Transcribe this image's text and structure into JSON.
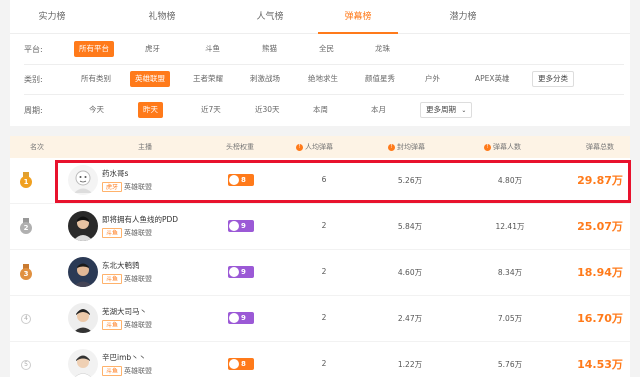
{
  "top_tabs": [
    {
      "label": "实力榜"
    },
    {
      "label": "礼物榜"
    },
    {
      "label": "人气榜"
    },
    {
      "label": "弹幕榜"
    },
    {
      "label": "潜力榜"
    }
  ],
  "filters": {
    "platform": {
      "label": "平台:",
      "options": [
        "所有平台",
        "虎牙",
        "斗鱼",
        "熊猫",
        "全民",
        "龙珠"
      ],
      "selected": "所有平台"
    },
    "category": {
      "label": "类别:",
      "options": [
        "所有类别",
        "英雄联盟",
        "王者荣耀",
        "刺激战场",
        "绝地求生",
        "颜值星秀",
        "户外",
        "APEX英雄"
      ],
      "more": "更多分类",
      "selected": "英雄联盟"
    },
    "period": {
      "label": "周期:",
      "options": [
        "今天",
        "昨天",
        "近7天",
        "近30天",
        "本周",
        "本月"
      ],
      "more": "更多周期",
      "selected": "昨天"
    }
  },
  "table": {
    "headers": {
      "rank": "名次",
      "streamer": "主播",
      "weight": "头榜权重",
      "per_person": "人均弹幕",
      "eps": "封均弹幕",
      "users": "弹幕人数",
      "total": "弹幕总数"
    },
    "rows": [
      {
        "rank": "1",
        "name": "药水哥s",
        "platform": "虎牙",
        "category": "英雄联盟",
        "weight": "8",
        "weight_color": "#ff7a1a",
        "per_person": "6",
        "eps": "5.26万",
        "users": "4.80万",
        "total": "29.87万"
      },
      {
        "rank": "2",
        "name": "即将拥有人鱼线的PDD",
        "platform": "斗鱼",
        "category": "英雄联盟",
        "weight": "9",
        "weight_color": "#9b59d6",
        "per_person": "2",
        "eps": "5.84万",
        "users": "12.41万",
        "total": "25.07万"
      },
      {
        "rank": "3",
        "name": "东北大鹌鹑",
        "platform": "斗鱼",
        "category": "英雄联盟",
        "weight": "9",
        "weight_color": "#9b59d6",
        "per_person": "2",
        "eps": "4.60万",
        "users": "8.34万",
        "total": "18.94万"
      },
      {
        "rank": "4",
        "name": "芜湖大司马丶",
        "platform": "斗鱼",
        "category": "英雄联盟",
        "weight": "9",
        "weight_color": "#9b59d6",
        "per_person": "2",
        "eps": "2.47万",
        "users": "7.05万",
        "total": "16.70万"
      },
      {
        "rank": "5",
        "name": "辛巴imb丶丶",
        "platform": "斗鱼",
        "category": "英雄联盟",
        "weight": "8",
        "weight_color": "#ff7a1a",
        "per_person": "2",
        "eps": "1.22万",
        "users": "5.76万",
        "total": "14.53万"
      }
    ]
  },
  "colors": {
    "accent": "#ff7a1a",
    "highlight": "#e8122d",
    "gold": "#f0a020",
    "silver": "#b0b0b0",
    "bronze": "#e09040"
  }
}
